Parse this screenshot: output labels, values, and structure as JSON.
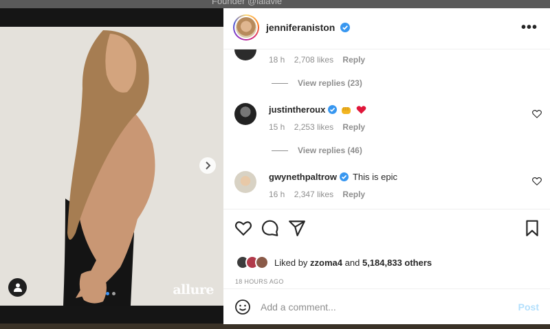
{
  "backdrop": {
    "text": "Founder @lalavie"
  },
  "media": {
    "watermark": "allure",
    "slide_count": 2,
    "active_slide": 1
  },
  "post": {
    "username": "jenniferaniston",
    "more_label": "•••"
  },
  "comments": [
    {
      "user": "",
      "text": "",
      "time": "18 h",
      "likes": "2,708 likes",
      "reply": "Reply",
      "view_replies": "View replies (23)"
    },
    {
      "user": "justintheroux",
      "text": "",
      "emoji": [
        "fist-emoji",
        "red-heart-emoji"
      ],
      "time": "15 h",
      "likes": "2,253 likes",
      "reply": "Reply",
      "view_replies": "View replies (46)"
    },
    {
      "user": "gwynethpaltrow",
      "text": "This is epic",
      "time": "16 h",
      "likes": "2,347 likes",
      "reply": "Reply"
    }
  ],
  "likes": {
    "prefix": "Liked by",
    "first_user": "zzoma4",
    "and": "and",
    "others": "5,184,833 others"
  },
  "timestamp": "18 HOURS AGO",
  "comment_box": {
    "placeholder": "Add a comment...",
    "post_label": "Post"
  },
  "colors": {
    "verified": "#3897f0",
    "post_disabled": "#b2dffc",
    "heart": "#ed4956"
  }
}
